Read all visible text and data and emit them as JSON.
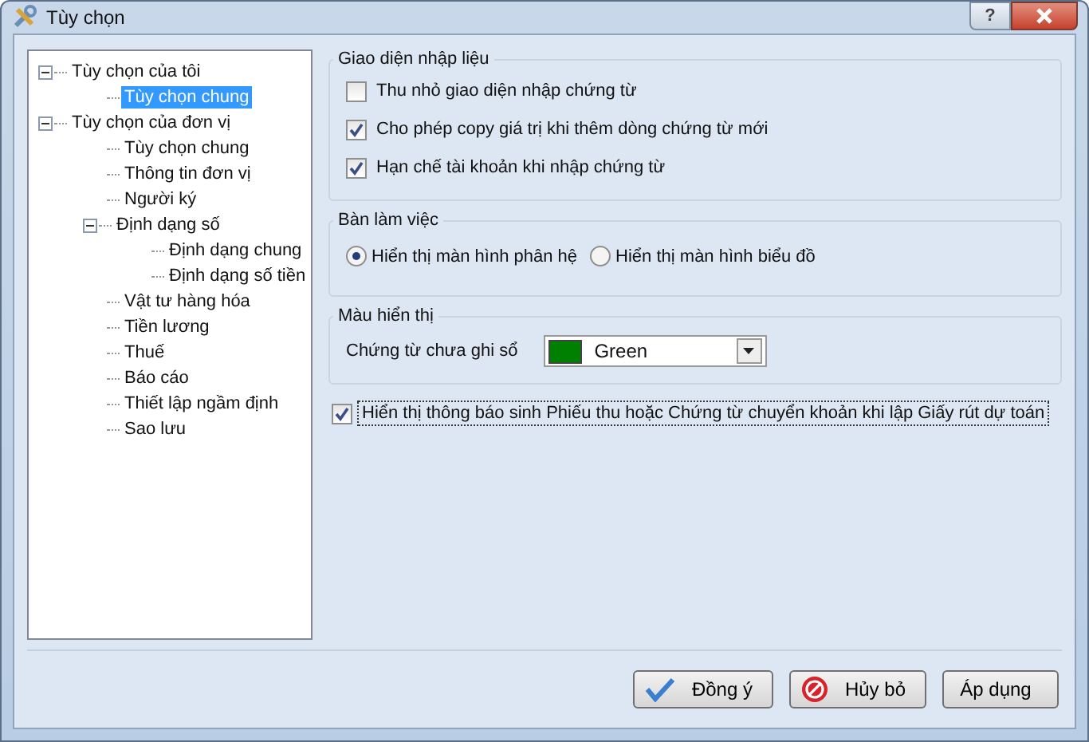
{
  "window": {
    "title": "Tùy chọn",
    "help_button": "?"
  },
  "tree": [
    {
      "label": "Tùy chọn của tôi",
      "expanded": true,
      "selected": false,
      "children": [
        {
          "label": "Tùy chọn chung",
          "selected": true
        }
      ]
    },
    {
      "label": "Tùy chọn của đơn vị",
      "expanded": true,
      "selected": false,
      "children": [
        {
          "label": "Tùy chọn chung",
          "selected": false
        },
        {
          "label": "Thông tin đơn vị",
          "selected": false
        },
        {
          "label": "Người ký",
          "selected": false
        },
        {
          "label": "Định dạng số",
          "expanded": true,
          "selected": false,
          "children": [
            {
              "label": "Định dạng chung",
              "selected": false
            },
            {
              "label": "Định dạng số tiền",
              "selected": false
            }
          ]
        },
        {
          "label": "Vật tư hàng hóa",
          "selected": false
        },
        {
          "label": "Tiền lương",
          "selected": false
        },
        {
          "label": "Thuế",
          "selected": false
        },
        {
          "label": "Báo cáo",
          "selected": false
        },
        {
          "label": "Thiết lập ngầm định",
          "selected": false
        },
        {
          "label": "Sao lưu",
          "selected": false
        }
      ]
    }
  ],
  "input_section": {
    "title": "Giao diện nhập liệu",
    "options": [
      {
        "label": "Thu nhỏ giao diện nhập chứng từ",
        "checked": false
      },
      {
        "label": "Cho phép copy giá trị khi thêm dòng chứng từ mới",
        "checked": true
      },
      {
        "label": "Hạn chế tài khoản khi nhập chứng từ",
        "checked": true
      }
    ]
  },
  "workspace_section": {
    "title": "Bàn làm việc",
    "options": [
      {
        "label": "Hiển thị màn hình phân hệ",
        "selected": true
      },
      {
        "label": "Hiển thị màn hình biểu đồ",
        "selected": false
      }
    ]
  },
  "color_section": {
    "title": "Màu hiển thị",
    "field_label": "Chứng từ chưa ghi sổ",
    "dropdown": {
      "value": "Green",
      "color": "#008000"
    }
  },
  "notify_option": {
    "label": "Hiển thị thông báo sinh Phiếu thu hoặc Chứng từ chuyển khoản khi lập Giấy rút dự toán",
    "checked": true
  },
  "buttons": [
    {
      "label": "Đồng ý",
      "kind": "ok"
    },
    {
      "label": "Hủy bỏ",
      "kind": "cancel"
    },
    {
      "label": "Áp dụng",
      "kind": "apply"
    }
  ]
}
